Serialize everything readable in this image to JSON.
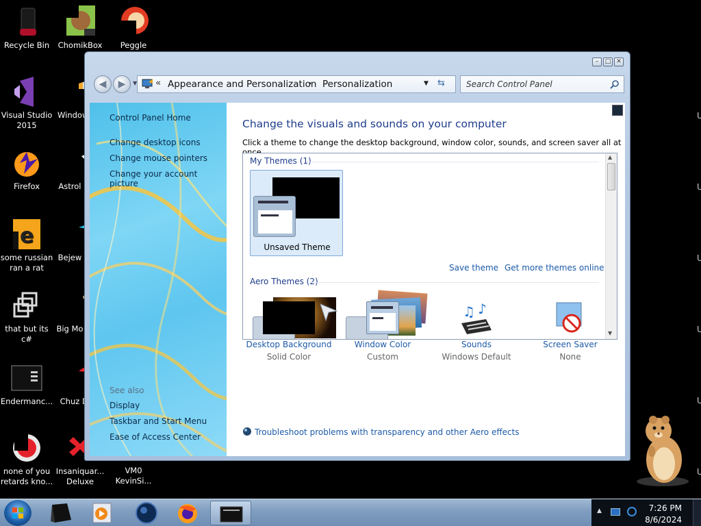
{
  "desktop": {
    "icons": [
      {
        "label": "Recycle Bin"
      },
      {
        "label": "ChomikBox"
      },
      {
        "label": "Peggle Deluxe"
      },
      {
        "label": "Visual Studio 2015"
      },
      {
        "label": "Window Ma"
      },
      {
        "label": "Firefox"
      },
      {
        "label": "Astrol Delu"
      },
      {
        "label": "some russian ran a rat"
      },
      {
        "label": "Bejew Delu"
      },
      {
        "label": "that but its c#"
      },
      {
        "label": "Big Mo Delu"
      },
      {
        "label": "Endermanc..."
      },
      {
        "label": "Chuz Delu"
      },
      {
        "label": "none of you retards kno..."
      },
      {
        "label": "Insaniquar... Deluxe"
      },
      {
        "label": "VM0 KevinSi..."
      }
    ],
    "edge_letter": "U"
  },
  "window": {
    "caption_buttons": {
      "minimize": "–",
      "maximize": "□",
      "close": "✕"
    },
    "address": {
      "chevron": "«",
      "crumb1": "Appearance and Personalization",
      "separator": "•",
      "crumb2": "Personalization"
    },
    "search": {
      "placeholder": "Search Control Panel"
    },
    "sidebar": {
      "home": "Control Panel Home",
      "links": [
        "Change desktop icons",
        "Change mouse pointers",
        "Change your account picture"
      ],
      "see_also": "See also",
      "see_also_links": [
        "Display",
        "Taskbar and Start Menu",
        "Ease of Access Center"
      ]
    },
    "main": {
      "heading": "Change the visuals and sounds on your computer",
      "subtext": "Click a theme to change the desktop background, window color, sounds, and screen saver all at once.",
      "my_themes": "My Themes (1)",
      "unsaved_theme": "Unsaved Theme",
      "save_theme": "Save theme",
      "get_more": "Get more themes online",
      "aero_themes": "Aero Themes (2)",
      "bottom": [
        {
          "title": "Desktop Background",
          "sub": "Solid Color"
        },
        {
          "title": "Window Color",
          "sub": "Custom"
        },
        {
          "title": "Sounds",
          "sub": "Windows Default"
        },
        {
          "title": "Screen Saver",
          "sub": "None"
        }
      ],
      "troubleshoot": "Troubleshoot problems with transparency and other Aero effects"
    }
  },
  "taskbar": {
    "time": "7:26 PM",
    "date": "8/6/2024"
  },
  "colors": {
    "link": "#1c5aa8",
    "heading": "#1e3c8c",
    "taskbar": "#8aa6c6"
  }
}
